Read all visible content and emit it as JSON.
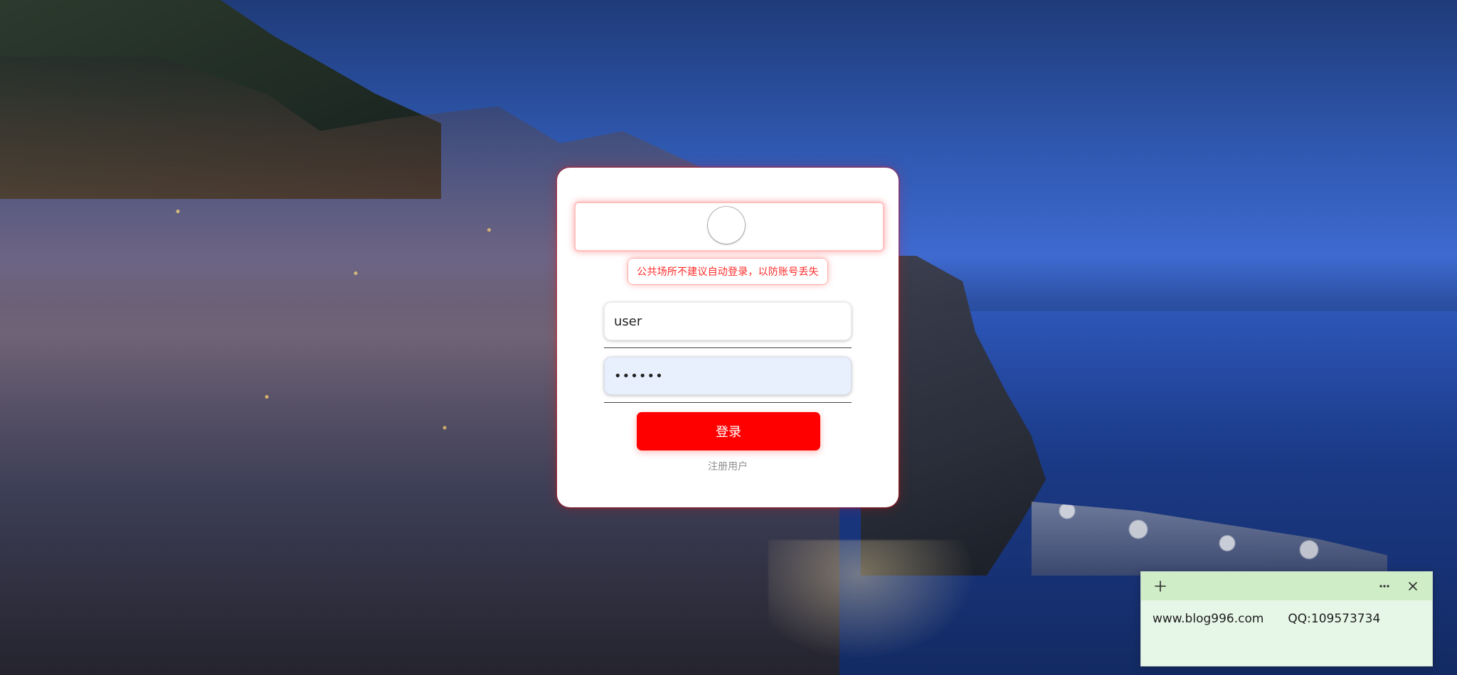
{
  "login": {
    "notice": "公共场所不建议自动登录，以防账号丢失",
    "username_value": "user",
    "password_value": "••••••",
    "login_button_label": "登录",
    "register_link_label": "注册用户"
  },
  "note_widget": {
    "text_left": "www.blog996.com",
    "text_right": "QQ:109573734",
    "icons": {
      "add": "plus-icon",
      "more": "more-horizontal-icon",
      "close": "close-icon"
    },
    "colors": {
      "header_bg": "#cfeec8",
      "body_bg": "#e7f7e7"
    }
  },
  "colors": {
    "accent_red": "#ff0000",
    "notice_red": "#ff2a2a",
    "password_bg": "#e8f0fe"
  }
}
